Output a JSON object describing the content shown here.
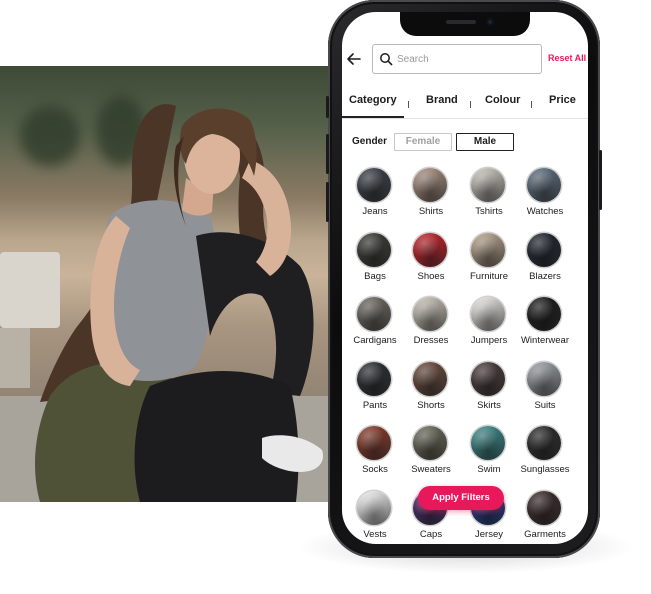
{
  "search": {
    "placeholder": "Search"
  },
  "header": {
    "reset_label": "Reset All"
  },
  "tabs": [
    {
      "label": "Category",
      "active": true
    },
    {
      "label": "Brand",
      "active": false
    },
    {
      "label": "Colour",
      "active": false
    },
    {
      "label": "Price",
      "active": false
    }
  ],
  "gender": {
    "label": "Gender",
    "options": [
      {
        "label": "Female",
        "selected": false
      },
      {
        "label": "Male",
        "selected": true
      }
    ]
  },
  "categories": [
    {
      "label": "Jeans",
      "icon": "jeans-icon"
    },
    {
      "label": "Shirts",
      "icon": "shirts-icon"
    },
    {
      "label": "Tshirts",
      "icon": "tshirts-icon"
    },
    {
      "label": "Watches",
      "icon": "watches-icon"
    },
    {
      "label": "Bags",
      "icon": "bags-icon"
    },
    {
      "label": "Shoes",
      "icon": "shoes-icon"
    },
    {
      "label": "Furniture",
      "icon": "furniture-icon"
    },
    {
      "label": "Blazers",
      "icon": "blazers-icon"
    },
    {
      "label": "Cardigans",
      "icon": "cardigans-icon"
    },
    {
      "label": "Dresses",
      "icon": "dresses-icon"
    },
    {
      "label": "Jumpers",
      "icon": "jumpers-icon"
    },
    {
      "label": "Winterwear",
      "icon": "winterwear-icon"
    },
    {
      "label": "Pants",
      "icon": "pants-icon"
    },
    {
      "label": "Shorts",
      "icon": "shorts-icon"
    },
    {
      "label": "Skirts",
      "icon": "skirts-icon"
    },
    {
      "label": "Suits",
      "icon": "suits-icon"
    },
    {
      "label": "Socks",
      "icon": "socks-icon"
    },
    {
      "label": "Sweaters",
      "icon": "sweaters-icon"
    },
    {
      "label": "Swim",
      "icon": "swim-icon"
    },
    {
      "label": "Sunglasses",
      "icon": "sunglasses-icon"
    },
    {
      "label": "Vests",
      "icon": "vests-icon"
    },
    {
      "label": "Caps",
      "icon": "caps-icon"
    },
    {
      "label": "Jersey",
      "icon": "jersey-icon"
    },
    {
      "label": "Garments",
      "icon": "garments-icon"
    }
  ],
  "apply_button": {
    "label": "Apply Filters"
  },
  "colors": {
    "accent": "#e8195a",
    "text": "#1c1c1c",
    "muted": "#a0a0a0"
  },
  "category_thumb_colors": [
    "#3a3f48",
    "#a88f80",
    "#c9c4bc",
    "#5d6f80",
    "#3a3a36",
    "#c4202a",
    "#b7a48c",
    "#1e2530",
    "#6e6a62",
    "#c9c1b5",
    "#e8e6e2",
    "#1a1a1a",
    "#2a2e32",
    "#6a4a3c",
    "#4a3a3a",
    "#9aa0a6",
    "#8a3a2a",
    "#6a6a5a",
    "#3a8a8a",
    "#2a2a2a",
    "#f0f0f0",
    "#4a2a6a",
    "#1a3a8a",
    "#3a2a2a"
  ]
}
